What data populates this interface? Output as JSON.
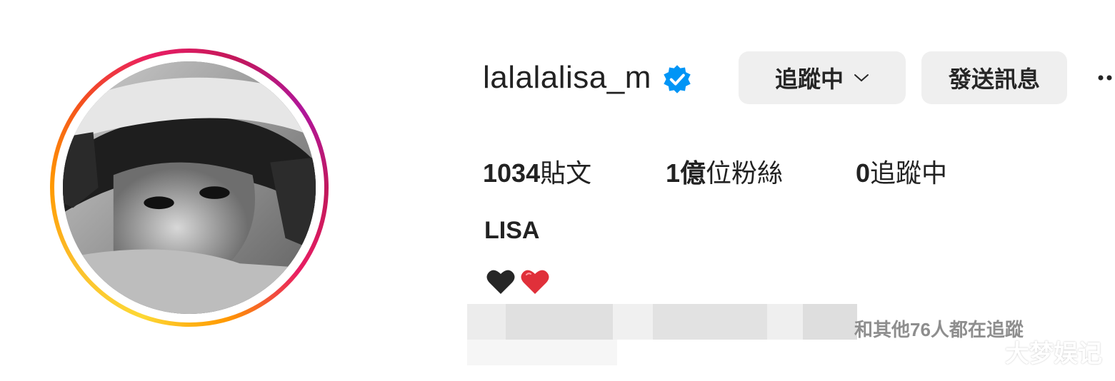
{
  "profile": {
    "username": "lalalalisa_m",
    "full_name": "LISA",
    "bio_emoji": [
      "black-heart",
      "red-heart"
    ],
    "verified": true
  },
  "actions": {
    "follow_label": "追蹤中",
    "message_label": "發送訊息"
  },
  "stats": {
    "posts_count": "1034",
    "posts_label": "貼文",
    "followers_count": "1億",
    "followers_label": "位粉絲",
    "following_count": "0",
    "following_label": "追蹤中"
  },
  "followed_by": {
    "text": "和其他76人都在追蹤"
  },
  "watermark": {
    "text": "大梦娱记"
  },
  "colors": {
    "verified_blue": "#0095f6",
    "button_bg": "#efefef",
    "ring_gradient": [
      "#fdd835",
      "#ff9800",
      "#e91e63",
      "#b0179b"
    ],
    "heart_red": "#e0303a",
    "heart_black": "#262626"
  }
}
